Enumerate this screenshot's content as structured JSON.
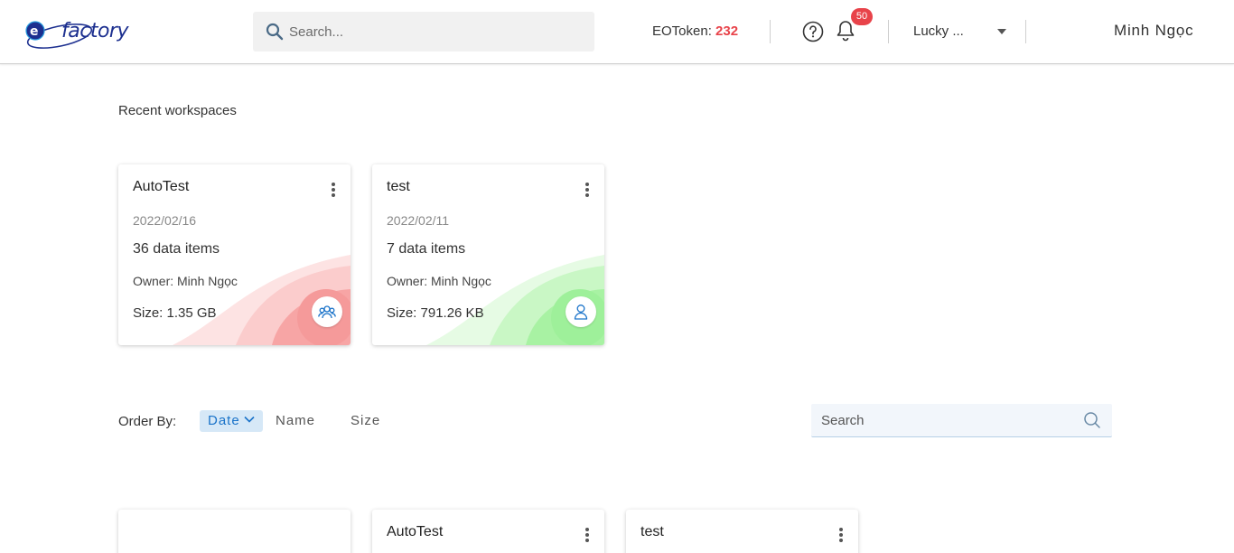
{
  "header": {
    "logo_text": "factory",
    "search_placeholder": "Search...",
    "token_label": "EOToken:",
    "token_value": "232",
    "notification_count": "50",
    "workspace_selector": "Lucky ...",
    "user_name": "Minh Ngọc"
  },
  "recent": {
    "title": "Recent workspaces",
    "cards": [
      {
        "name": "AutoTest",
        "date": "2022/02/16",
        "items": "36 data items",
        "owner": "Owner: Minh Ngọc",
        "size": "Size: 1.35 GB",
        "type_icon": "group-icon",
        "accent": "#f7a5a5"
      },
      {
        "name": "test",
        "date": "2022/02/11",
        "items": "7 data items",
        "owner": "Owner: Minh Ngọc",
        "size": "Size: 791.26 KB",
        "type_icon": "user-icon",
        "accent": "#9ef09a"
      }
    ]
  },
  "order": {
    "label": "Order By:",
    "options": [
      "Date",
      "Name",
      "Size"
    ],
    "selected": "Date",
    "search_placeholder": "Search"
  },
  "list": {
    "cards": [
      {
        "name": ""
      },
      {
        "name": "AutoTest"
      },
      {
        "name": "test"
      }
    ]
  },
  "colors": {
    "accent_blue": "#1a73c9",
    "token_red": "#e8434a",
    "brand_navy": "#1c2f8f"
  }
}
